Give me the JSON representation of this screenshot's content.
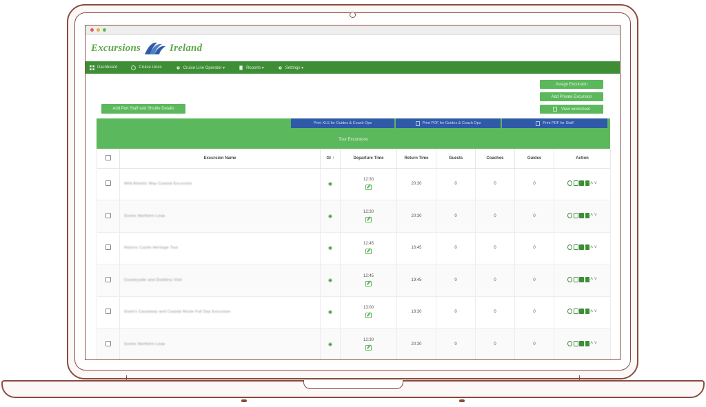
{
  "brand": {
    "name_left": "Excursions",
    "name_right": "Ireland",
    "color": "#5fa84b"
  },
  "navbar": {
    "items": [
      {
        "label": "Dashboard",
        "icon": "grid-icon"
      },
      {
        "label": "Cruise Lines",
        "icon": "globe-icon"
      },
      {
        "label": "Cruise Line Operator ▾",
        "icon": "gear-icon"
      },
      {
        "label": "Reports ▾",
        "icon": "document-icon"
      },
      {
        "label": "Settings ▾",
        "icon": "gear-icon"
      }
    ]
  },
  "buttons": {
    "assign_excursion": "Assign Excursion",
    "add_private_excursion": "Add Private Excursion",
    "view_worksheet": "View worksheet",
    "add_staff_shuttle": "Add Port Staff and Shuttle Details",
    "print_xls": "Print XLS for Guides & Coach Ops",
    "print_pdf_guides": "Print PDF for Guides & Coach Ops",
    "print_pdf_staff": "Print PDF for Staff"
  },
  "panel": {
    "title": "Tour Excursions"
  },
  "table": {
    "headers": {
      "name": "Excursion Name",
      "gi": "GI ↑",
      "departure": "Departure Time",
      "return": "Return Time",
      "guests": "Guests",
      "coaches": "Coaches",
      "guides": "Guides",
      "action": "Action"
    },
    "rows": [
      {
        "name": "Wild Atlantic Way Coastal Excursion",
        "departure": "12:30",
        "return": "20:30",
        "guests": "0",
        "coaches": "0",
        "guides": "0"
      },
      {
        "name": "Scenic Northern Loop",
        "departure": "12:30",
        "return": "20:30",
        "guests": "0",
        "coaches": "0",
        "guides": "0"
      },
      {
        "name": "Historic Castle Heritage Tour",
        "departure": "12:45",
        "return": "16:45",
        "guests": "0",
        "coaches": "0",
        "guides": "0"
      },
      {
        "name": "Countryside and Distillery Visit",
        "departure": "12:45",
        "return": "19:45",
        "guests": "0",
        "coaches": "0",
        "guides": "0"
      },
      {
        "name": "Giant's Causeway and Coastal Route Full Day Excursion",
        "departure": "13:00",
        "return": "18:30",
        "guests": "0",
        "coaches": "0",
        "guides": "0"
      },
      {
        "name": "Scenic Northern Loop",
        "departure": "12:30",
        "return": "20:30",
        "guests": "0",
        "coaches": "0",
        "guides": "0"
      }
    ]
  },
  "colors": {
    "green_dark": "#3e8e36",
    "green": "#5cb85c",
    "blue": "#2e5aa8",
    "frame": "#8a4a3c"
  }
}
